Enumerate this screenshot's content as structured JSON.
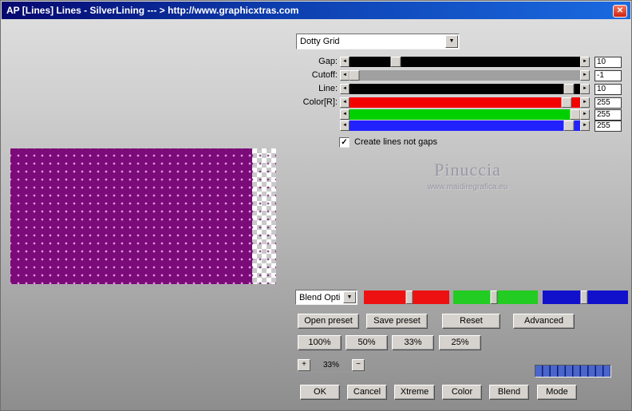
{
  "window": {
    "title": "AP [Lines]  Lines - SilverLining    --- > http://www.graphicxtras.com"
  },
  "icons": {
    "close": "✕",
    "dropdown_arrow": "▼",
    "check": "✓",
    "slider_left": "◄",
    "slider_right": "►"
  },
  "preset_dropdown": {
    "value": "Dotty Grid"
  },
  "sliders": [
    {
      "label": "Gap:",
      "value": "10",
      "track_color": "#000000",
      "thumb_left": "20%"
    },
    {
      "label": "Cutoff:",
      "value": "-1",
      "track_color": "#a0a0a0",
      "thumb_left": "2%"
    },
    {
      "label": "Line:",
      "value": "10",
      "track_color": "#000000",
      "thumb_left": "95%"
    },
    {
      "label": "Color[R]:",
      "value": "255",
      "track_color": "#f40000",
      "thumb_left": "94%"
    },
    {
      "label": "",
      "value": "255",
      "track_color": "#00d000",
      "thumb_left": "98%"
    },
    {
      "label": "",
      "value": "255",
      "track_color": "#2222ff",
      "thumb_left": "95%"
    }
  ],
  "checkbox": {
    "label": "Create lines not gaps",
    "checked": true
  },
  "watermark": {
    "title": "Pinuccia",
    "subtitle": "www.maidiregrafica.eu"
  },
  "blend_dropdown": {
    "value": "Blend Opti"
  },
  "rgb_sliders": [
    {
      "name": "red",
      "color": "#ee1111",
      "thumb_left": "53%"
    },
    {
      "name": "green",
      "color": "#22cc22",
      "thumb_left": "48%"
    },
    {
      "name": "blue",
      "color": "#1111cc",
      "thumb_left": "49%"
    }
  ],
  "preset_buttons": {
    "open": "Open preset",
    "save": "Save preset",
    "reset": "Reset",
    "advanced": "Advanced"
  },
  "scale_buttons": {
    "b100": "100%",
    "b50": "50%",
    "b33": "33%",
    "b25": "25%"
  },
  "zoom_control": {
    "plus": "+",
    "value": "33%",
    "minus": "−"
  },
  "progress": {
    "segment_color": "#4a66cc",
    "gap_color": "#0e1a6e"
  },
  "bottom_buttons": {
    "ok": "OK",
    "cancel": "Cancel",
    "xtreme": "Xtreme",
    "color": "Color",
    "blend": "Blend",
    "mode": "Mode"
  }
}
